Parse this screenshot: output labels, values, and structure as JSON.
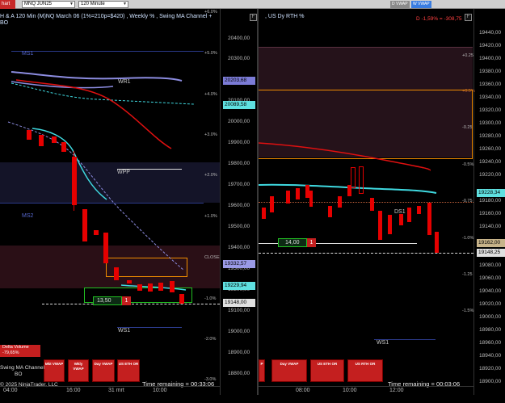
{
  "toolbar": {
    "app_label": "hart",
    "instrument": "MNQ JUN25",
    "timeframe": "120 Minute",
    "chip_vwap": "D VWAP",
    "chip_wvwap": "W VWAP"
  },
  "left": {
    "title": "H & A 120 Min  (M)NQ March 06 (1%=210p=$420) , Weekly % , Swing MA Channel + BO",
    "pct_labels": [
      "+6.0%",
      "+5.0%",
      "+4.0%",
      "+3.0%",
      "+2.0%",
      "+1.0%",
      "CLOSE",
      "-1.0%",
      "-2.0%",
      "-3.0%"
    ],
    "price_ticks": [
      "20400,00",
      "20300,00",
      "20100,00",
      "20000,00",
      "19900,00",
      "19800,00",
      "19700,00",
      "19600,00",
      "19500,00",
      "19400,00",
      "19300,00",
      "19200,00",
      "19100,00",
      "19000,00",
      "18900,00",
      "18800,00"
    ],
    "tags": [
      {
        "text": "20203,68",
        "color": "#7b7bd6"
      },
      {
        "text": "20089,58",
        "color": "#5fe0e0"
      },
      {
        "text": "19332,57",
        "color": "#9a9ae6"
      },
      {
        "text": "19229,94",
        "color": "#5fe0e0"
      },
      {
        "text": "19148,00",
        "color": "#e0e0e0"
      }
    ],
    "level_labels": {
      "ms1": "MS1",
      "wr1": "WR1",
      "wpp": "WPP",
      "ms2": "MS2",
      "ws1": "WS1"
    },
    "position_price": "13,50",
    "position_qty": "1",
    "delta_volume_label": "Delta Volume",
    "delta_volume_value": "-79,65%",
    "buttons": [
      "Mkt VWAP",
      "Wkly VWAP",
      "Day VWAP",
      "US ETH OR"
    ],
    "channel_label": "Swing MA Channel",
    "channel_sub": "BO",
    "copyright": "© 2025 NinjaTrader, LLC",
    "time_remaining": "Time remaining = 00:33:06",
    "x_ticks": [
      "04:00",
      "16:00",
      "31 mrt",
      "10:00"
    ],
    "f_button": "F"
  },
  "right": {
    "title": ", US Dy RTH %",
    "d_readout": "D -1,59% = -308,75",
    "pct_labels": [
      "+0.25",
      "+0.5%",
      "-0.25",
      "-0.5%",
      "-0.75",
      "-1.0%",
      "-1.25",
      "-1.5%"
    ],
    "price_ticks": [
      "19440,00",
      "19420,00",
      "19400,00",
      "19380,00",
      "19360,00",
      "19340,00",
      "19320,00",
      "19300,00",
      "19280,00",
      "19260,00",
      "19240,00",
      "19220,00",
      "19200,00",
      "19180,00",
      "19160,00",
      "19140,00",
      "19120,00",
      "19100,00",
      "19080,00",
      "19060,00",
      "19040,00",
      "19020,00",
      "19000,00",
      "18980,00",
      "18960,00",
      "18940,00",
      "18920,00",
      "18900,00",
      "18880,00"
    ],
    "tags": [
      {
        "text": "19228,34",
        "color": "#5fe0e0"
      },
      {
        "text": "19162,00",
        "color": "#c8b48a"
      },
      {
        "text": "19148,25",
        "color": "#e0e0e0"
      }
    ],
    "level_labels": {
      "ds1": "DS1",
      "ws1": "WS1"
    },
    "position_price": "14,00",
    "position_qty": "1",
    "buttons": [
      "P",
      "Day VWAP",
      "US ETH OR",
      "US RTH OR"
    ],
    "time_remaining": "Time remaining = 00:03:06",
    "x_ticks": [
      "08:00",
      "10:00",
      "12:00"
    ],
    "f_button": "F"
  },
  "colors": {
    "bear_candle": "#e60000",
    "wr1_line": "#8c8ce0",
    "cyan_ma": "#3fd9e0",
    "red_ma": "#e01010",
    "orange_box": "#f08c00",
    "green_box": "#22c022"
  }
}
